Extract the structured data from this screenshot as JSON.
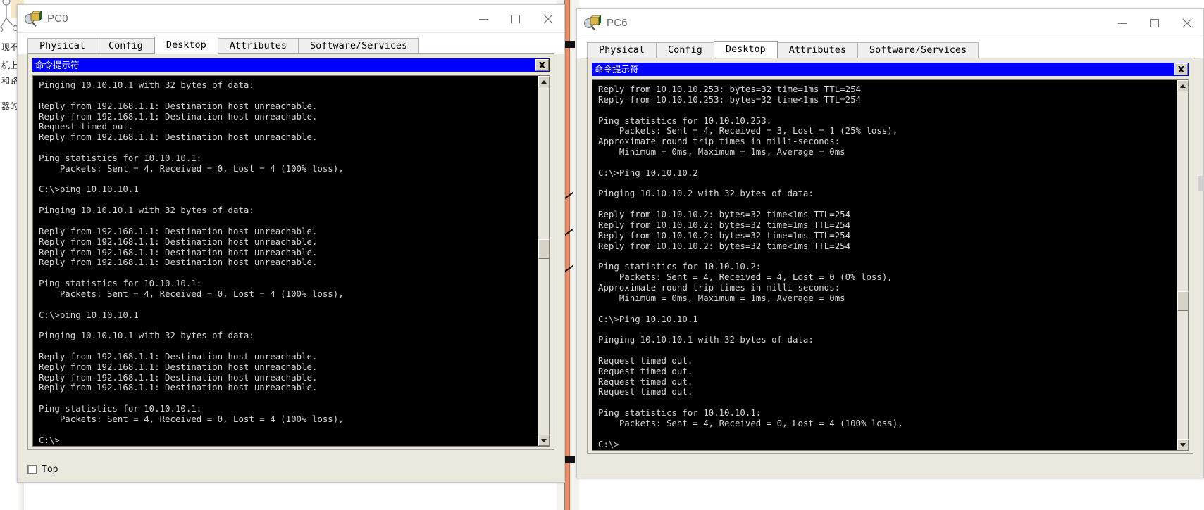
{
  "background_doc": {
    "lines": [
      "现不",
      "机上",
      "和路",
      "器的"
    ]
  },
  "windows": [
    {
      "id": "pc0",
      "title": "PC0",
      "icon": "pc-device-icon",
      "window_controls": {
        "minimize": "minimize-icon",
        "maximize": "maximize-icon",
        "close": "close-icon"
      },
      "tabs": [
        {
          "label": "Physical",
          "active": false
        },
        {
          "label": "Config",
          "active": false
        },
        {
          "label": "Desktop",
          "active": true
        },
        {
          "label": "Attributes",
          "active": false
        },
        {
          "label": "Software/Services",
          "active": false
        }
      ],
      "cmd": {
        "title": "命令提示符",
        "close_label": "X",
        "scroll_up": "scroll-up-arrow-icon",
        "scroll_down": "scroll-down-arrow-icon",
        "content": "Pinging 10.10.10.1 with 32 bytes of data:\n\nReply from 192.168.1.1: Destination host unreachable.\nReply from 192.168.1.1: Destination host unreachable.\nRequest timed out.\nReply from 192.168.1.1: Destination host unreachable.\n\nPing statistics for 10.10.10.1:\n    Packets: Sent = 4, Received = 0, Lost = 4 (100% loss),\n\nC:\\>ping 10.10.10.1\n\nPinging 10.10.10.1 with 32 bytes of data:\n\nReply from 192.168.1.1: Destination host unreachable.\nReply from 192.168.1.1: Destination host unreachable.\nReply from 192.168.1.1: Destination host unreachable.\nReply from 192.168.1.1: Destination host unreachable.\n\nPing statistics for 10.10.10.1:\n    Packets: Sent = 4, Received = 0, Lost = 4 (100% loss),\n\nC:\\>ping 10.10.10.1\n\nPinging 10.10.10.1 with 32 bytes of data:\n\nReply from 192.168.1.1: Destination host unreachable.\nReply from 192.168.1.1: Destination host unreachable.\nReply from 192.168.1.1: Destination host unreachable.\nReply from 192.168.1.1: Destination host unreachable.\n\nPing statistics for 10.10.10.1:\n    Packets: Sent = 4, Received = 0, Lost = 4 (100% loss),\n\nC:\\>"
      },
      "top_checkbox": {
        "label": "Top",
        "checked": false
      }
    },
    {
      "id": "pc6",
      "title": "PC6",
      "icon": "pc-device-icon",
      "window_controls": {
        "minimize": "minimize-icon",
        "maximize": "maximize-icon",
        "close": "close-icon"
      },
      "tabs": [
        {
          "label": "Physical",
          "active": false
        },
        {
          "label": "Config",
          "active": false
        },
        {
          "label": "Desktop",
          "active": true
        },
        {
          "label": "Attributes",
          "active": false
        },
        {
          "label": "Software/Services",
          "active": false
        }
      ],
      "cmd": {
        "title": "命令提示符",
        "close_label": "X",
        "scroll_up": "scroll-up-arrow-icon",
        "scroll_down": "scroll-down-arrow-icon",
        "content": "Reply from 10.10.10.253: bytes=32 time=1ms TTL=254\nReply from 10.10.10.253: bytes=32 time<1ms TTL=254\n\nPing statistics for 10.10.10.253:\n    Packets: Sent = 4, Received = 3, Lost = 1 (25% loss),\nApproximate round trip times in milli-seconds:\n    Minimum = 0ms, Maximum = 1ms, Average = 0ms\n\nC:\\>Ping 10.10.10.2\n\nPinging 10.10.10.2 with 32 bytes of data:\n\nReply from 10.10.10.2: bytes=32 time<1ms TTL=254\nReply from 10.10.10.2: bytes=32 time=1ms TTL=254\nReply from 10.10.10.2: bytes=32 time=1ms TTL=254\nReply from 10.10.10.2: bytes=32 time<1ms TTL=254\n\nPing statistics for 10.10.10.2:\n    Packets: Sent = 4, Received = 4, Lost = 0 (0% loss),\nApproximate round trip times in milli-seconds:\n    Minimum = 0ms, Maximum = 1ms, Average = 0ms\n\nC:\\>Ping 10.10.10.1\n\nPinging 10.10.10.1 with 32 bytes of data:\n\nRequest timed out.\nRequest timed out.\nRequest timed out.\nRequest timed out.\n\nPing statistics for 10.10.10.1:\n    Packets: Sent = 4, Received = 0, Lost = 4 (100% loss),\n\nC:\\>"
      }
    }
  ],
  "colors": {
    "cmd_titlebar": "#0000ff",
    "terminal_bg": "#000000",
    "terminal_fg": "#d8d8d8",
    "panel_bg": "#ebe9de",
    "wire_orange": "#e8906a"
  }
}
